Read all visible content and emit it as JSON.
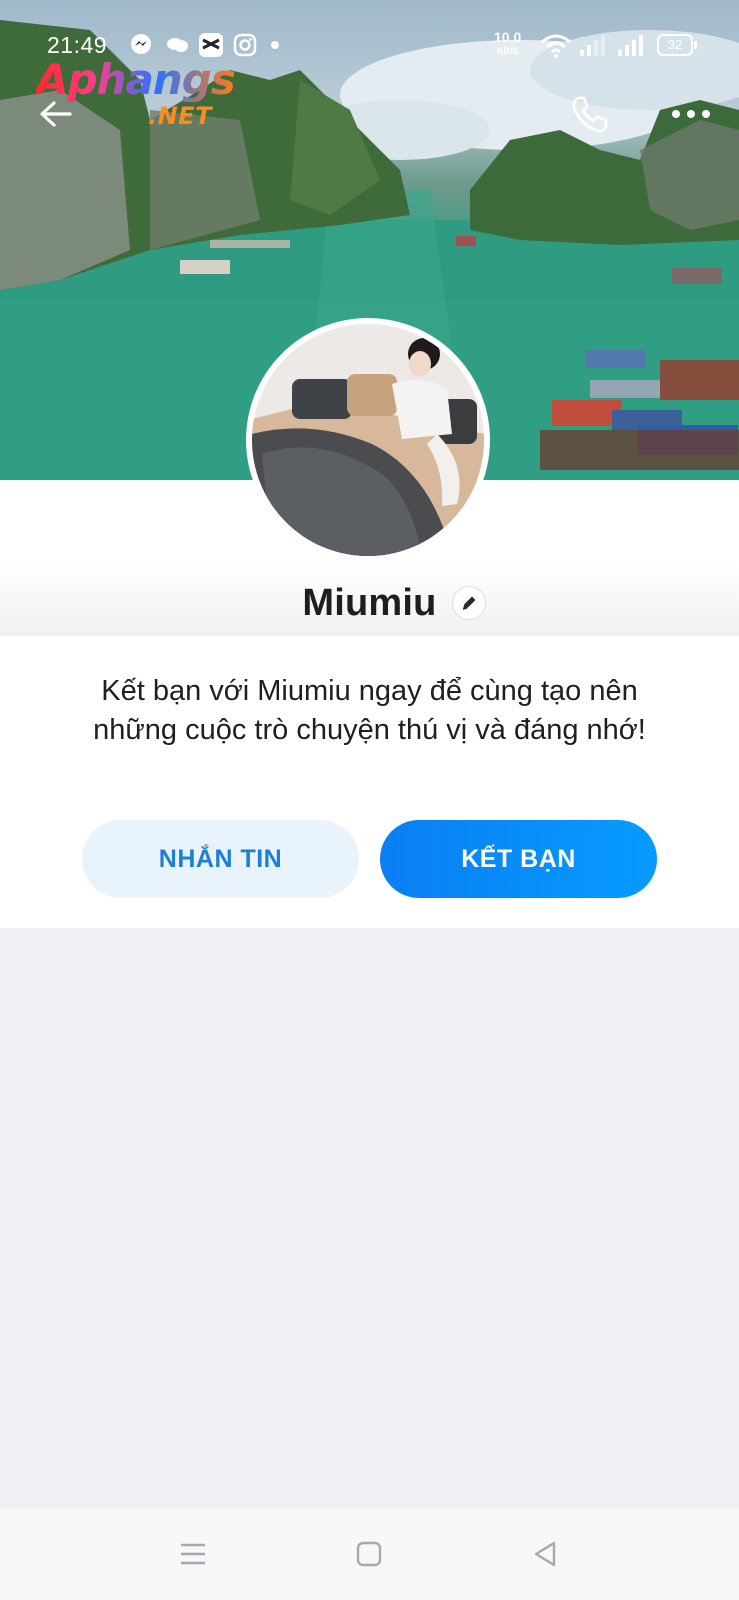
{
  "status_bar": {
    "time": "21:49",
    "speed_value": "10.0",
    "speed_unit": "KB/S",
    "battery": "32",
    "icons": [
      "messenger-icon",
      "chat-bubble-icon",
      "capcut-icon",
      "instagram-icon",
      "dot-icon",
      "wifi-icon",
      "signal-icon",
      "signal-icon"
    ]
  },
  "watermark": {
    "line1": "Aphangs",
    "line2": ".NET"
  },
  "header": {
    "icons": [
      "back-arrow-icon",
      "phone-icon",
      "more-dots-icon"
    ]
  },
  "profile": {
    "name": "Miumiu",
    "intro": "Kết bạn với Miumiu ngay để cùng tạo nên những cuộc trò chuyện thú vị và đáng nhớ!"
  },
  "actions": {
    "message_label": "NHẮN TIN",
    "add_friend_label": "KẾT BẠN"
  },
  "colors": {
    "accent": "#0a8cf7",
    "secondary_button_bg": "#e9f3fb",
    "secondary_button_text": "#1d7fd6",
    "page_bg": "#eff1f5"
  },
  "nav_bar": {
    "icons": [
      "menu-icon",
      "home-square-icon",
      "back-triangle-icon"
    ]
  }
}
